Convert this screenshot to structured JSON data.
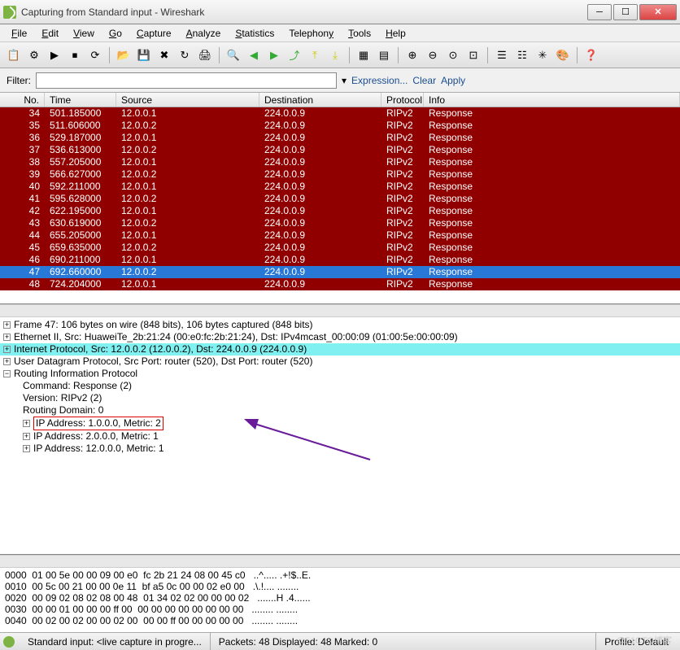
{
  "window": {
    "title": "Capturing from Standard input - Wireshark"
  },
  "menu": [
    "File",
    "Edit",
    "View",
    "Go",
    "Capture",
    "Analyze",
    "Statistics",
    "Telephony",
    "Tools",
    "Help"
  ],
  "filter": {
    "label": "Filter:",
    "value": "",
    "dropdown": "▾",
    "expression": "Expression...",
    "clear": "Clear",
    "apply": "Apply"
  },
  "columns": {
    "no": "No.",
    "time": "Time",
    "source": "Source",
    "destination": "Destination",
    "protocol": "Protocol",
    "info": "Info"
  },
  "packets": [
    {
      "no": "34",
      "time": "501.185000",
      "src": "12.0.0.1",
      "dst": "224.0.0.9",
      "proto": "RIPv2",
      "info": "Response"
    },
    {
      "no": "35",
      "time": "511.606000",
      "src": "12.0.0.2",
      "dst": "224.0.0.9",
      "proto": "RIPv2",
      "info": "Response"
    },
    {
      "no": "36",
      "time": "529.187000",
      "src": "12.0.0.1",
      "dst": "224.0.0.9",
      "proto": "RIPv2",
      "info": "Response"
    },
    {
      "no": "37",
      "time": "536.613000",
      "src": "12.0.0.2",
      "dst": "224.0.0.9",
      "proto": "RIPv2",
      "info": "Response"
    },
    {
      "no": "38",
      "time": "557.205000",
      "src": "12.0.0.1",
      "dst": "224.0.0.9",
      "proto": "RIPv2",
      "info": "Response"
    },
    {
      "no": "39",
      "time": "566.627000",
      "src": "12.0.0.2",
      "dst": "224.0.0.9",
      "proto": "RIPv2",
      "info": "Response"
    },
    {
      "no": "40",
      "time": "592.211000",
      "src": "12.0.0.1",
      "dst": "224.0.0.9",
      "proto": "RIPv2",
      "info": "Response"
    },
    {
      "no": "41",
      "time": "595.628000",
      "src": "12.0.0.2",
      "dst": "224.0.0.9",
      "proto": "RIPv2",
      "info": "Response"
    },
    {
      "no": "42",
      "time": "622.195000",
      "src": "12.0.0.1",
      "dst": "224.0.0.9",
      "proto": "RIPv2",
      "info": "Response"
    },
    {
      "no": "43",
      "time": "630.619000",
      "src": "12.0.0.2",
      "dst": "224.0.0.9",
      "proto": "RIPv2",
      "info": "Response"
    },
    {
      "no": "44",
      "time": "655.205000",
      "src": "12.0.0.1",
      "dst": "224.0.0.9",
      "proto": "RIPv2",
      "info": "Response"
    },
    {
      "no": "45",
      "time": "659.635000",
      "src": "12.0.0.2",
      "dst": "224.0.0.9",
      "proto": "RIPv2",
      "info": "Response"
    },
    {
      "no": "46",
      "time": "690.211000",
      "src": "12.0.0.1",
      "dst": "224.0.0.9",
      "proto": "RIPv2",
      "info": "Response"
    },
    {
      "no": "47",
      "time": "692.660000",
      "src": "12.0.0.2",
      "dst": "224.0.0.9",
      "proto": "RIPv2",
      "info": "Response",
      "selected": true
    },
    {
      "no": "48",
      "time": "724.204000",
      "src": "12.0.0.1",
      "dst": "224.0.0.9",
      "proto": "RIPv2",
      "info": "Response"
    }
  ],
  "details": {
    "frame": "Frame 47: 106 bytes on wire (848 bits), 106 bytes captured (848 bits)",
    "eth": "Ethernet II, Src: HuaweiTe_2b:21:24 (00:e0:fc:2b:21:24), Dst: IPv4mcast_00:00:09 (01:00:5e:00:00:09)",
    "ip": "Internet Protocol, Src: 12.0.0.2 (12.0.0.2), Dst: 224.0.0.9 (224.0.0.9)",
    "udp": "User Datagram Protocol, Src Port: router (520), Dst Port: router (520)",
    "rip": "Routing Information Protocol",
    "cmd": "Command: Response (2)",
    "ver": "Version: RIPv2 (2)",
    "dom": "Routing Domain: 0",
    "addr1": "IP Address: 1.0.0.0, Metric: 2",
    "addr2": "IP Address: 2.0.0.0, Metric: 1",
    "addr3": "IP Address: 12.0.0.0, Metric: 1"
  },
  "hex": [
    {
      "off": "0000",
      "bytes": "01 00 5e 00 00 09 00 e0  fc 2b 21 24 08 00 45 c0",
      "ascii": "..^..... .+!$..E."
    },
    {
      "off": "0010",
      "bytes": "00 5c 00 21 00 00 0e 11  bf a5 0c 00 00 02 e0 00",
      "ascii": ".\\.!.... ........"
    },
    {
      "off": "0020",
      "bytes": "00 09 02 08 02 08 00 48  01 34 02 02 00 00 00 02",
      "ascii": ".......H .4......"
    },
    {
      "off": "0030",
      "bytes": "00 00 01 00 00 00 ff 00  00 00 00 00 00 00 00 00",
      "ascii": "........ ........"
    },
    {
      "off": "0040",
      "bytes": "00 02 00 02 00 00 02 00  00 00 ff 00 00 00 00 00",
      "ascii": "........ ........"
    }
  ],
  "status": {
    "file": "Standard input: <live capture in progre...",
    "packets": "Packets: 48 Displayed: 48 Marked: 0",
    "profile": "Profile: Default"
  },
  "watermark": "@51CTO博客"
}
